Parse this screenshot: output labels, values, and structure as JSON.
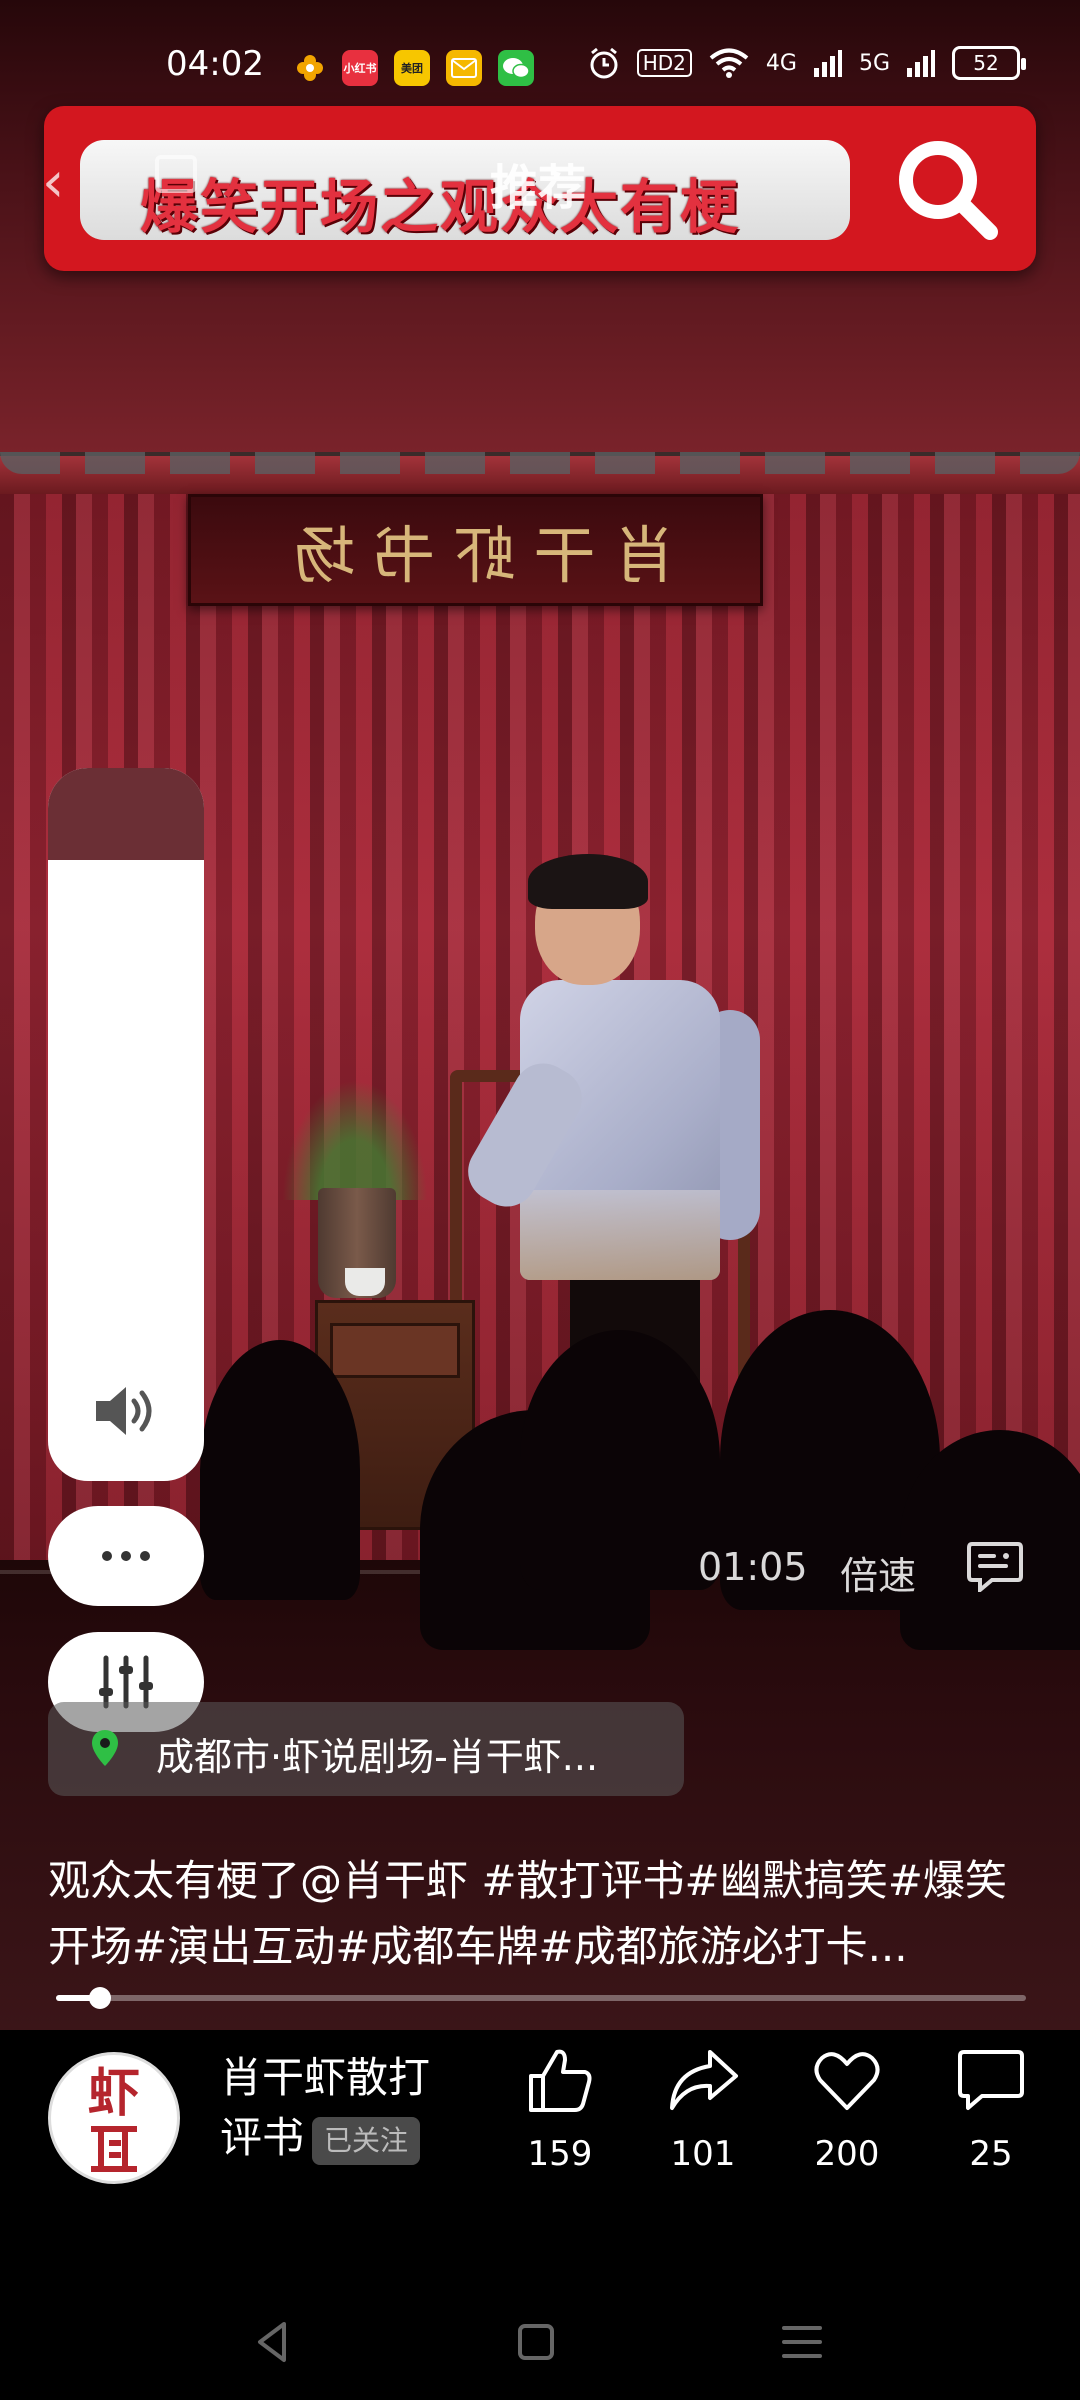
{
  "status_bar": {
    "time": "04:02",
    "apps": [
      {
        "name": "flower-icon",
        "label": "",
        "color": "#f2a400"
      },
      {
        "name": "xiaohongshu-icon",
        "label": "小红书",
        "color": "#e8303f"
      },
      {
        "name": "meituan-icon",
        "label": "美团",
        "color": "#f7c600"
      },
      {
        "name": "mail-icon",
        "label": "",
        "color": "#f5b800"
      },
      {
        "name": "wechat-icon",
        "label": "",
        "color": "#2fbf45"
      }
    ],
    "hd_badge": "HD2",
    "net_4g": "4G",
    "net_5g": "5G",
    "battery": "52"
  },
  "header": {
    "search_banner_text": "爆笑开场之观众太有梗",
    "tab_recommend": "推荐"
  },
  "video": {
    "plaque": "肖干虾书场",
    "elapsed": "01:05",
    "speed_label": "倍速"
  },
  "controls": {
    "more_label": "···"
  },
  "location": {
    "text": "成都市·虾说剧场-肖干虾..."
  },
  "description": {
    "line1": "观众太有梗了@肖干虾 #散打评书#幽默搞笑#爆笑",
    "line2": "开场#演出互动#成都车牌#成都旅游必打卡..."
  },
  "progress": {
    "fraction": 0.045
  },
  "author": {
    "avatar_text": "虾",
    "name": "肖干虾散打评书",
    "name_line1": "肖干虾散打",
    "name_line2": "评书",
    "follow_status": "已关注"
  },
  "actions": [
    {
      "id": "like",
      "icon": "thumbs-up-icon",
      "count": "159"
    },
    {
      "id": "share",
      "icon": "share-icon",
      "count": "101"
    },
    {
      "id": "favorite",
      "icon": "heart-icon",
      "count": "200"
    },
    {
      "id": "comment",
      "icon": "comment-icon",
      "count": "25"
    }
  ],
  "colors": {
    "banner_red": "#d3171f",
    "curtain_red": "#a62838"
  }
}
